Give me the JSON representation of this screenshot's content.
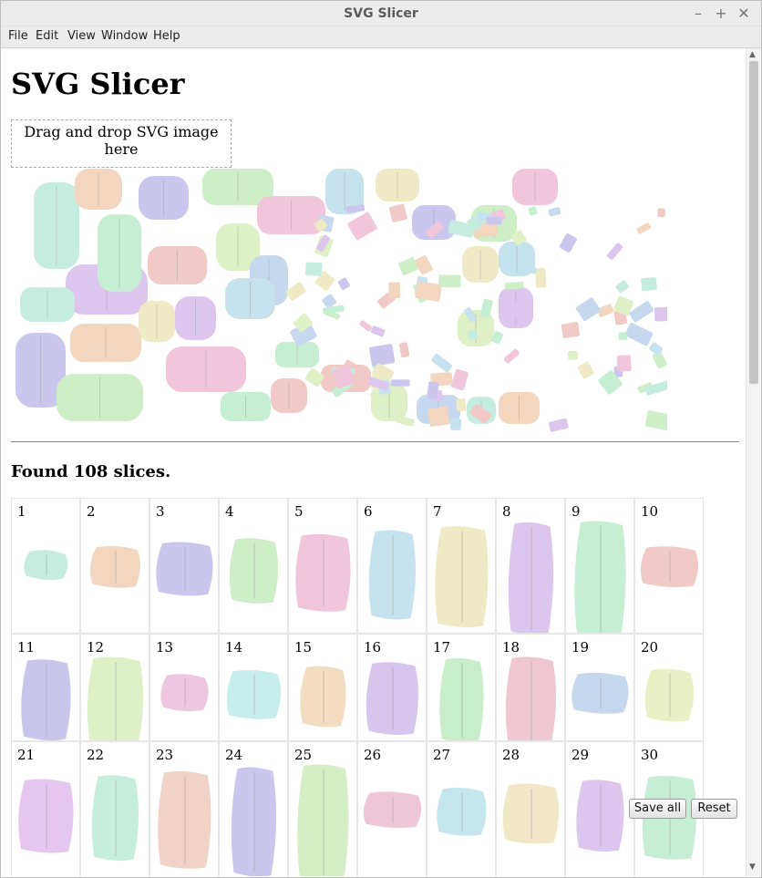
{
  "window": {
    "title": "SVG Slicer"
  },
  "menu": [
    "File",
    "Edit",
    "View",
    "Window",
    "Help"
  ],
  "page": {
    "heading": "SVG Slicer",
    "drop_zone": "Drag and drop SVG image here",
    "found_text": "Found 108 slices."
  },
  "slices": [
    {
      "n": "1",
      "c": "#c6ece0"
    },
    {
      "n": "2",
      "c": "#f3d6bf"
    },
    {
      "n": "3",
      "c": "#cbc6ee"
    },
    {
      "n": "4",
      "c": "#cdeec6"
    },
    {
      "n": "5",
      "c": "#f1c6da"
    },
    {
      "n": "6",
      "c": "#c6e2ee"
    },
    {
      "n": "7",
      "c": "#eeeac6"
    },
    {
      "n": "8",
      "c": "#dcc6ee"
    },
    {
      "n": "9",
      "c": "#c6eed2"
    },
    {
      "n": "10",
      "c": "#f1c9c6"
    },
    {
      "n": "11",
      "c": "#c9c6ee"
    },
    {
      "n": "12",
      "c": "#dff0c6"
    },
    {
      "n": "13",
      "c": "#efc6e0"
    },
    {
      "n": "14",
      "c": "#c6eeea"
    },
    {
      "n": "15",
      "c": "#f3dcbf"
    },
    {
      "n": "16",
      "c": "#d6c6ee"
    },
    {
      "n": "17",
      "c": "#c8eec9"
    },
    {
      "n": "18",
      "c": "#f0c6d0"
    },
    {
      "n": "19",
      "c": "#c6d8ee"
    },
    {
      "n": "20",
      "c": "#eaf0c6"
    },
    {
      "n": "21",
      "c": "#e4c6ee"
    },
    {
      "n": "22",
      "c": "#c6eedc"
    },
    {
      "n": "23",
      "c": "#f1d2c6"
    },
    {
      "n": "24",
      "c": "#cac6ee"
    },
    {
      "n": "25",
      "c": "#d4eec6"
    },
    {
      "n": "26",
      "c": "#efc6d8"
    },
    {
      "n": "27",
      "c": "#c6e6ee"
    },
    {
      "n": "28",
      "c": "#f0e8c6"
    },
    {
      "n": "29",
      "c": "#dcc6ee"
    },
    {
      "n": "30",
      "c": "#c6eed6"
    }
  ],
  "buttons": {
    "save_all": "Save all",
    "reset": "Reset"
  },
  "palette": [
    "#c6ece0",
    "#f3d6bf",
    "#cbc6ee",
    "#cdeec6",
    "#f1c6da",
    "#c6e2ee",
    "#eeeac6",
    "#dcc6ee",
    "#c6eed2",
    "#f1c9c6",
    "#dff0c6",
    "#c6d8ee"
  ]
}
